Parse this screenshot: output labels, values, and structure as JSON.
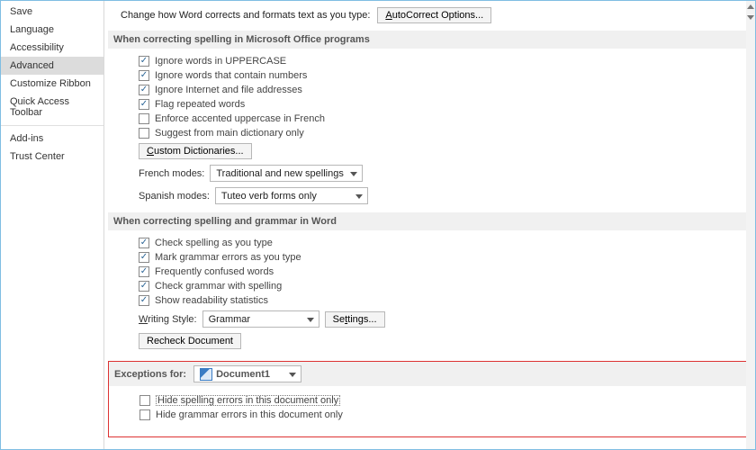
{
  "sidebar": {
    "items": [
      {
        "label": "Save"
      },
      {
        "label": "Language"
      },
      {
        "label": "Accessibility"
      },
      {
        "label": "Advanced",
        "selected": true
      },
      {
        "label": "Customize Ribbon"
      },
      {
        "label": "Quick Access Toolbar"
      },
      {
        "label": "Add-ins"
      },
      {
        "label": "Trust Center"
      }
    ]
  },
  "top": {
    "intro": "Change how Word corrects and formats text as you type:",
    "autocorrect_btn": "AutoCorrect Options..."
  },
  "sec1": {
    "title": "When correcting spelling in Microsoft Office programs",
    "c1": "Ignore words in UPPERCASE",
    "c2": "Ignore words that contain numbers",
    "c3": "Ignore Internet and file addresses",
    "c4": "Flag repeated words",
    "c5": "Enforce accented uppercase in French",
    "c6": "Suggest from main dictionary only",
    "dict_btn": "Custom Dictionaries...",
    "french_label": "French modes:",
    "french_value": "Traditional and new spellings",
    "spanish_label": "Spanish modes:",
    "spanish_value": "Tuteo verb forms only"
  },
  "sec2": {
    "title": "When correcting spelling and grammar in Word",
    "c1": "Check spelling as you type",
    "c2": "Mark grammar errors as you type",
    "c3": "Frequently confused words",
    "c4": "Check grammar with spelling",
    "c5": "Show readability statistics",
    "style_label": "Writing Style:",
    "style_value": "Grammar",
    "settings_btn": "Settings...",
    "recheck_btn": "Recheck Document"
  },
  "exc": {
    "title": "Exceptions for:",
    "doc": "Document1",
    "c1": "Hide spelling errors in this document only",
    "c2": "Hide grammar errors in this document only"
  }
}
